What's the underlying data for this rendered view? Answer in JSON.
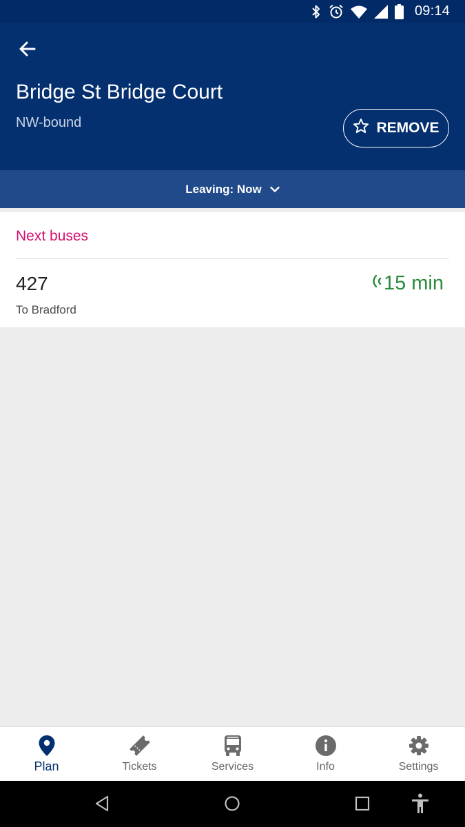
{
  "status_bar": {
    "time": "09:14",
    "icons": [
      "bluetooth-icon",
      "alarm-icon",
      "wifi-icon",
      "cell-signal-icon",
      "battery-icon"
    ]
  },
  "header": {
    "back_icon": "arrow-left-icon",
    "title": "Bridge St Bridge Court",
    "direction": "NW-bound",
    "remove_label": "REMOVE",
    "remove_icon": "star-outline-icon"
  },
  "leaving": {
    "label": "Leaving: Now",
    "icon": "chevron-down-icon"
  },
  "next_buses": {
    "title": "Next buses",
    "items": [
      {
        "route": "427",
        "destination": "To Bradford",
        "eta": "15 min",
        "realtime_icon": "live-signal-icon"
      }
    ]
  },
  "bottom_nav": {
    "active": "Plan",
    "items": [
      {
        "label": "Plan",
        "icon": "map-pin-icon"
      },
      {
        "label": "Tickets",
        "icon": "ticket-icon"
      },
      {
        "label": "Services",
        "icon": "bus-icon"
      },
      {
        "label": "Info",
        "icon": "info-icon"
      },
      {
        "label": "Settings",
        "icon": "gear-icon"
      }
    ]
  },
  "colors": {
    "header_bg": "#05306f",
    "status_bg": "#022a66",
    "leaving_bg": "#214a8a",
    "accent_pink": "#d4116f",
    "eta_green": "#2b8a3e",
    "nav_active": "#05306f",
    "page_bg": "#ededed"
  }
}
